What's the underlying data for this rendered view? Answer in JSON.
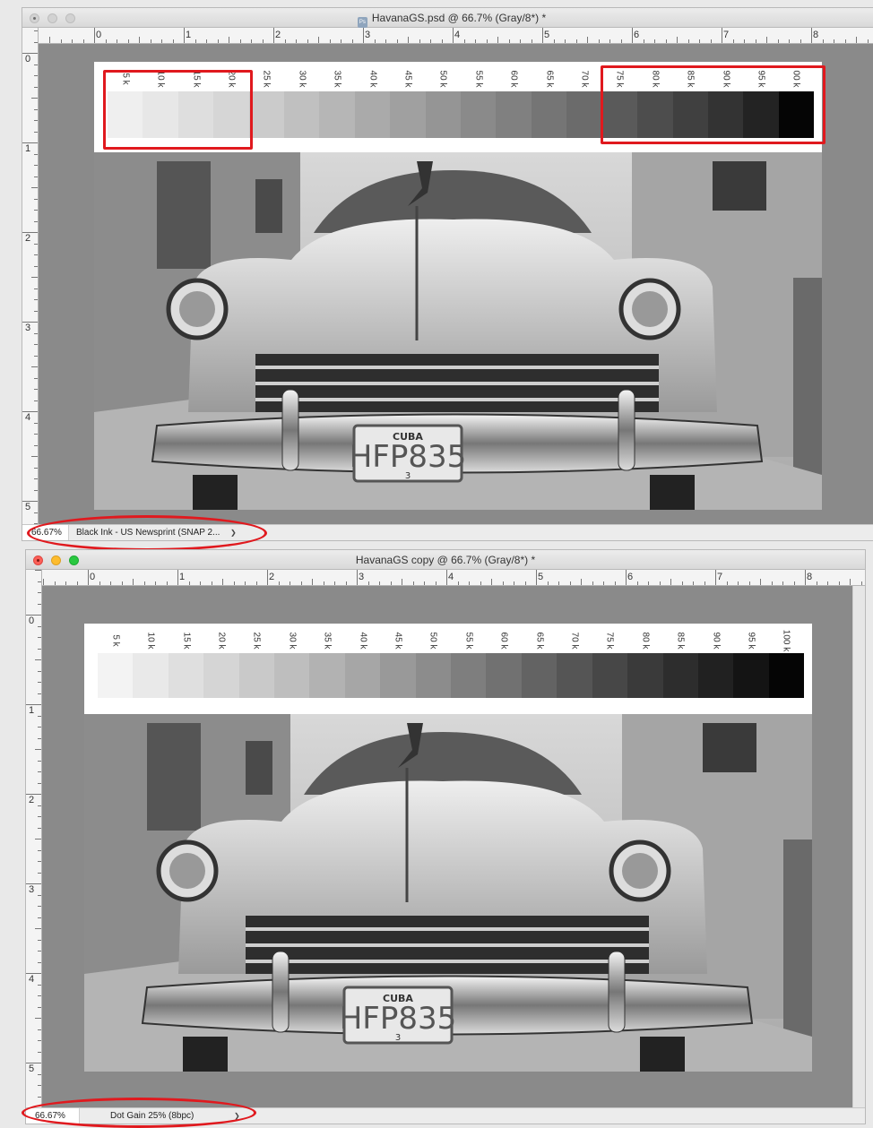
{
  "window1": {
    "title": "HavanaGS.psd @ 66.7% (Gray/8*) *",
    "ps_badge": "Ps",
    "ruler_h_labels": [
      "0",
      "1",
      "2",
      "3",
      "4",
      "5",
      "6",
      "7",
      "8"
    ],
    "ruler_v_labels": [
      "0",
      "1",
      "2",
      "3",
      "4",
      "5"
    ],
    "zoom": "66.67%",
    "profile": "Black Ink - US Newsprint (SNAP 2...",
    "chevron": "❯",
    "swatch_labels": [
      "5 k",
      "10 k",
      "15 k",
      "20 k",
      "25 k",
      "30 k",
      "35 k",
      "40 k",
      "45 k",
      "50 k",
      "55 k",
      "60 k",
      "65 k",
      "70 k",
      "75 k",
      "80 k",
      "85 k",
      "90 k",
      "95 k",
      "00 k"
    ],
    "swatch_colors": [
      "#efefef",
      "#e7e7e7",
      "#dedede",
      "#d6d6d6",
      "#cbcbcb",
      "#c0c0c0",
      "#b6b6b6",
      "#aaaaaa",
      "#a0a0a0",
      "#959595",
      "#8a8a8a",
      "#808080",
      "#757575",
      "#6b6b6b",
      "#5a5a5a",
      "#4d4d4d",
      "#404040",
      "#333333",
      "#232323",
      "#050505"
    ],
    "plate": {
      "top": "CUBA",
      "number": "HFP835",
      "bottom": "3"
    }
  },
  "window2": {
    "title": "HavanaGS copy @ 66.7% (Gray/8*) *",
    "ruler_h_labels": [
      "0",
      "1",
      "2",
      "3",
      "4",
      "5",
      "6",
      "7",
      "8"
    ],
    "ruler_v_labels": [
      "0",
      "1",
      "2",
      "3",
      "4",
      "5"
    ],
    "zoom": "66.67%",
    "profile": "Dot Gain 25% (8bpc)",
    "chevron": "❯",
    "swatch_labels": [
      "5 k",
      "10 k",
      "15 k",
      "20 k",
      "25 k",
      "30 k",
      "35 k",
      "40 k",
      "45 k",
      "50 k",
      "55 k",
      "60 k",
      "65 k",
      "70 k",
      "75 k",
      "80 k",
      "85 k",
      "90 k",
      "95 k",
      "100 k"
    ],
    "swatch_colors": [
      "#f3f3f3",
      "#e9e9e9",
      "#dfdfdf",
      "#d5d5d5",
      "#c9c9c9",
      "#bebebe",
      "#b2b2b2",
      "#a6a6a6",
      "#999999",
      "#8c8c8c",
      "#7e7e7e",
      "#717171",
      "#636363",
      "#555555",
      "#474747",
      "#3a3a3a",
      "#2d2d2d",
      "#212121",
      "#141414",
      "#050505"
    ],
    "plate": {
      "top": "CUBA",
      "number": "HFP835",
      "bottom": "3"
    }
  },
  "colors": {
    "annotation": "#e0191e",
    "canvas": "#8a8a8a"
  }
}
